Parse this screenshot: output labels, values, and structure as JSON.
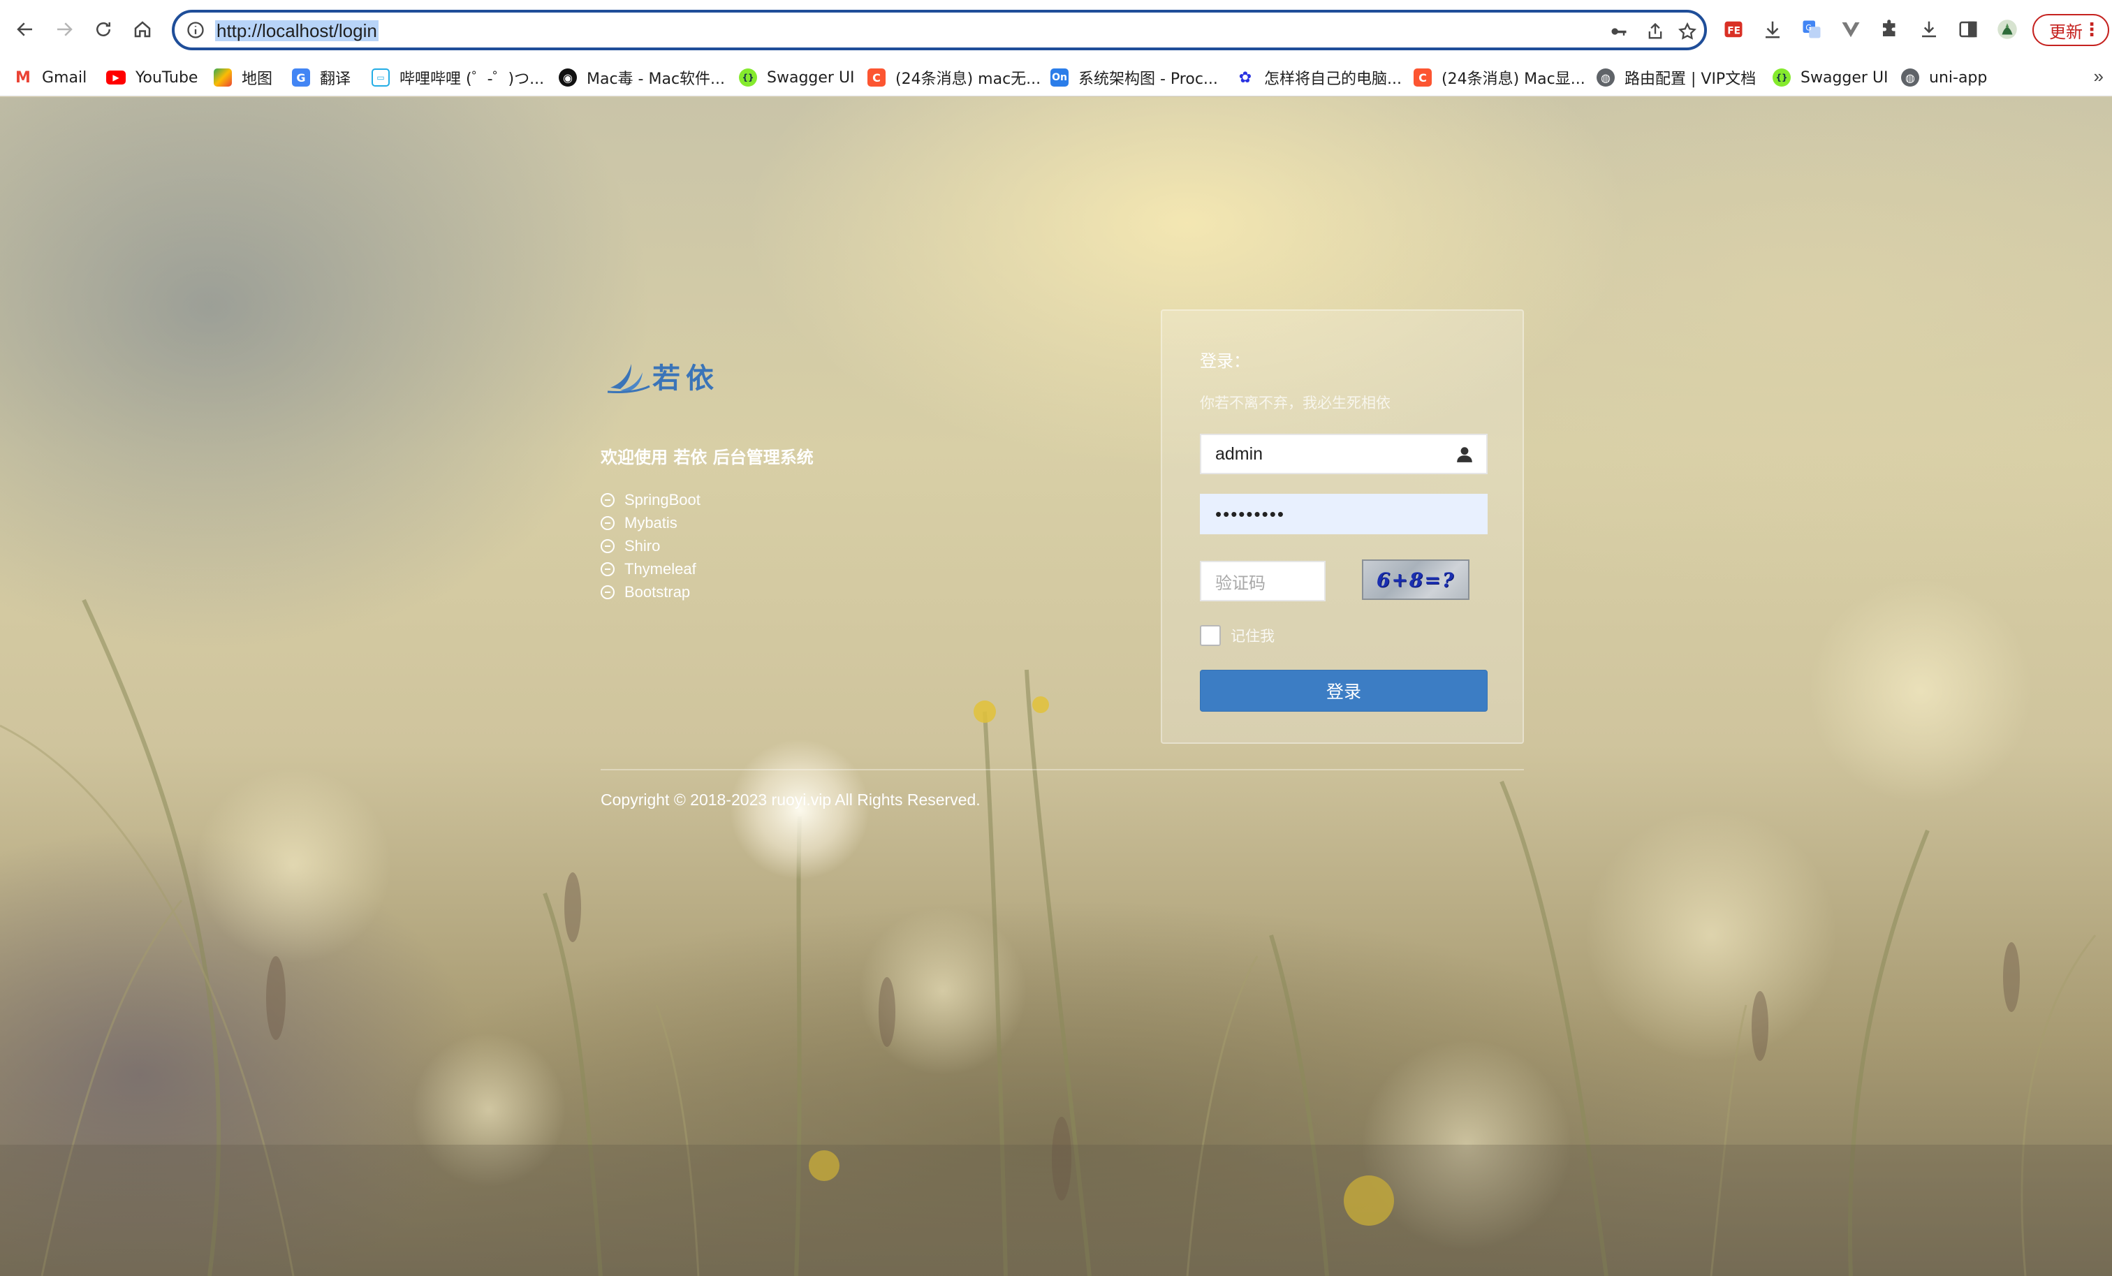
{
  "browser": {
    "url": "http://localhost/login",
    "update_label": "更新",
    "bookmarks": [
      {
        "label": "Gmail",
        "icon": "gmail-icon",
        "color": "#ea4335",
        "glyph": "M"
      },
      {
        "label": "YouTube",
        "icon": "youtube-icon",
        "color": "#ff0000",
        "glyph": "▶"
      },
      {
        "label": "地图",
        "icon": "maps-icon",
        "color": "#34a853",
        "glyph": "⬤"
      },
      {
        "label": "翻译",
        "icon": "translate-icon",
        "color": "#4285f4",
        "glyph": "G"
      },
      {
        "label": "哔哩哔哩 (゜-゜)つ...",
        "icon": "bilibili-icon",
        "color": "#23ade5",
        "glyph": "▭"
      },
      {
        "label": "Mac毒 - Mac软件...",
        "icon": "macdu-icon",
        "color": "#111111",
        "glyph": "◉"
      },
      {
        "label": "Swagger UI",
        "icon": "swagger-icon",
        "color": "#85ea2d",
        "glyph": "{}"
      },
      {
        "label": "(24条消息) mac无...",
        "icon": "csdn-icon",
        "color": "#fc5531",
        "glyph": "C"
      },
      {
        "label": "系统架构图 - Proc...",
        "icon": "processon-icon",
        "color": "#2b7de9",
        "glyph": "On"
      },
      {
        "label": "怎样将自己的电脑...",
        "icon": "baidu-icon",
        "color": "#2932e1",
        "glyph": "✿"
      },
      {
        "label": "(24条消息) Mac显...",
        "icon": "csdn-icon",
        "color": "#fc5531",
        "glyph": "C"
      },
      {
        "label": "路由配置 | VIP文档",
        "icon": "globe-icon",
        "color": "#5f6368",
        "glyph": "◍"
      },
      {
        "label": "Swagger UI",
        "icon": "swagger-icon",
        "color": "#85ea2d",
        "glyph": "{}"
      },
      {
        "label": "uni-app",
        "icon": "globe-icon",
        "color": "#5f6368",
        "glyph": "◍"
      }
    ],
    "more": "»"
  },
  "intro": {
    "logo_text": "若依",
    "welcome": "欢迎使用 若依 后台管理系统",
    "features": [
      "SpringBoot",
      "Mybatis",
      "Shiro",
      "Thymeleaf",
      "Bootstrap"
    ]
  },
  "login": {
    "title": "登录：",
    "subtitle": "你若不离不弃，我必生死相依",
    "username": "admin",
    "password_mask": "•••••••••",
    "captcha_placeholder": "验证码",
    "captcha_text": "6+8=?",
    "remember_label": "记住我",
    "submit_label": "登录"
  },
  "footer": {
    "copyright": "Copyright © 2018-2023 ruoyi.vip All Rights Reserved."
  },
  "colors": {
    "accent": "#3c7dc4",
    "omnibox_border": "#1f4e99",
    "update": "#c5221f"
  }
}
